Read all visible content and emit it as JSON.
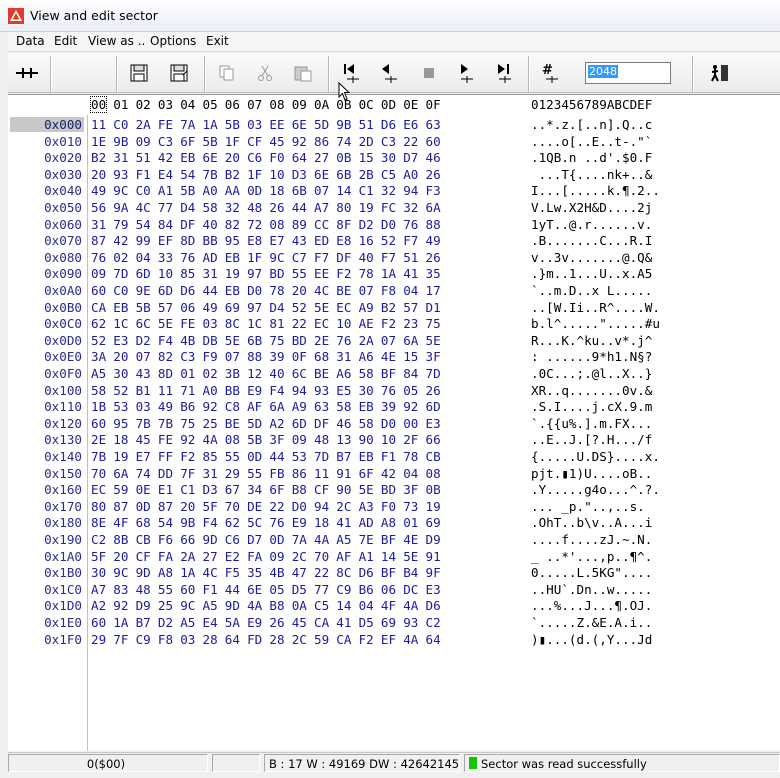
{
  "window": {
    "title": "View and edit sector"
  },
  "menu": [
    "Data",
    "Edit",
    "View as ..",
    "Options",
    "Exit"
  ],
  "toolbar": {
    "sector_value": "2048"
  },
  "header": {
    "cols": [
      "00",
      "01",
      "02",
      "03",
      "04",
      "05",
      "06",
      "07",
      "08",
      "09",
      "0A",
      "0B",
      "0C",
      "0D",
      "0E",
      "0F"
    ],
    "ascii_header": "0123456789ABCDEF"
  },
  "rows": [
    {
      "off": "0x000",
      "hex": [
        "11",
        "C0",
        "2A",
        "FE",
        "7A",
        "1A",
        "5B",
        "03",
        "EE",
        "6E",
        "5D",
        "9B",
        "51",
        "D6",
        "E6",
        "63"
      ],
      "ascii": "..*.z.[..n].Q..c"
    },
    {
      "off": "0x010",
      "hex": [
        "1E",
        "9B",
        "09",
        "C3",
        "6F",
        "5B",
        "1F",
        "CF",
        "45",
        "92",
        "86",
        "74",
        "2D",
        "C3",
        "22",
        "60"
      ],
      "ascii": "....o[..E..t-.\"`"
    },
    {
      "off": "0x020",
      "hex": [
        "B2",
        "31",
        "51",
        "42",
        "EB",
        "6E",
        "20",
        "C6",
        "F0",
        "64",
        "27",
        "0B",
        "15",
        "30",
        "D7",
        "46"
      ],
      "ascii": ".1QB.n ..d'.$0.F"
    },
    {
      "off": "0x030",
      "hex": [
        "20",
        "93",
        "F1",
        "E4",
        "54",
        "7B",
        "B2",
        "1F",
        "10",
        "D3",
        "6E",
        "6B",
        "2B",
        "C5",
        "A0",
        "26"
      ],
      "ascii": " ...T{....nk+..&"
    },
    {
      "off": "0x040",
      "hex": [
        "49",
        "9C",
        "C0",
        "A1",
        "5B",
        "A0",
        "AA",
        "0D",
        "18",
        "6B",
        "07",
        "14",
        "C1",
        "32",
        "94",
        "F3"
      ],
      "ascii": "I...[.....k.¶.2.."
    },
    {
      "off": "0x050",
      "hex": [
        "56",
        "9A",
        "4C",
        "77",
        "D4",
        "58",
        "32",
        "48",
        "26",
        "44",
        "A7",
        "80",
        "19",
        "FC",
        "32",
        "6A"
      ],
      "ascii": "V.Lw.X2H&D....2j"
    },
    {
      "off": "0x060",
      "hex": [
        "31",
        "79",
        "54",
        "84",
        "DF",
        "40",
        "82",
        "72",
        "08",
        "89",
        "CC",
        "8F",
        "D2",
        "D0",
        "76",
        "88"
      ],
      "ascii": "1yT..@.r......v."
    },
    {
      "off": "0x070",
      "hex": [
        "87",
        "42",
        "99",
        "EF",
        "8D",
        "BB",
        "95",
        "E8",
        "E7",
        "43",
        "ED",
        "E8",
        "16",
        "52",
        "F7",
        "49"
      ],
      "ascii": ".B.......C...R.I"
    },
    {
      "off": "0x080",
      "hex": [
        "76",
        "02",
        "04",
        "33",
        "76",
        "AD",
        "EB",
        "1F",
        "9C",
        "C7",
        "F7",
        "DF",
        "40",
        "F7",
        "51",
        "26"
      ],
      "ascii": "v..3v.......@.Q&"
    },
    {
      "off": "0x090",
      "hex": [
        "09",
        "7D",
        "6D",
        "10",
        "85",
        "31",
        "19",
        "97",
        "BD",
        "55",
        "EE",
        "F2",
        "78",
        "1A",
        "41",
        "35"
      ],
      "ascii": ".}m..1...U..x.A5"
    },
    {
      "off": "0x0A0",
      "hex": [
        "60",
        "C0",
        "9E",
        "6D",
        "D6",
        "44",
        "EB",
        "D0",
        "78",
        "20",
        "4C",
        "BE",
        "07",
        "F8",
        "04",
        "17"
      ],
      "ascii": "`..m.D..x L....."
    },
    {
      "off": "0x0B0",
      "hex": [
        "CA",
        "EB",
        "5B",
        "57",
        "06",
        "49",
        "69",
        "97",
        "D4",
        "52",
        "5E",
        "EC",
        "A9",
        "B2",
        "57",
        "D1"
      ],
      "ascii": "..[W.Ii..R^....W."
    },
    {
      "off": "0x0C0",
      "hex": [
        "62",
        "1C",
        "6C",
        "5E",
        "FE",
        "03",
        "8C",
        "1C",
        "81",
        "22",
        "EC",
        "10",
        "AE",
        "F2",
        "23",
        "75"
      ],
      "ascii": "b.l^.....\".....#u"
    },
    {
      "off": "0x0D0",
      "hex": [
        "52",
        "E3",
        "D2",
        "F4",
        "4B",
        "DB",
        "5E",
        "6B",
        "75",
        "BD",
        "2E",
        "76",
        "2A",
        "07",
        "6A",
        "5E"
      ],
      "ascii": "R...K.^ku..v*.j^"
    },
    {
      "off": "0x0E0",
      "hex": [
        "3A",
        "20",
        "07",
        "82",
        "C3",
        "F9",
        "07",
        "88",
        "39",
        "0F",
        "68",
        "31",
        "A6",
        "4E",
        "15",
        "3F"
      ],
      "ascii": ": ......9*h1.N§?"
    },
    {
      "off": "0x0F0",
      "hex": [
        "A5",
        "30",
        "43",
        "8D",
        "01",
        "02",
        "3B",
        "12",
        "40",
        "6C",
        "BE",
        "A6",
        "58",
        "BF",
        "84",
        "7D"
      ],
      "ascii": ".0C...;.@l..X..}"
    },
    {
      "off": "0x100",
      "hex": [
        "58",
        "52",
        "B1",
        "11",
        "71",
        "A0",
        "BB",
        "E9",
        "F4",
        "94",
        "93",
        "E5",
        "30",
        "76",
        "05",
        "26"
      ],
      "ascii": "XR..q.......0v.&"
    },
    {
      "off": "0x110",
      "hex": [
        "1B",
        "53",
        "03",
        "49",
        "B6",
        "92",
        "C8",
        "AF",
        "6A",
        "A9",
        "63",
        "58",
        "EB",
        "39",
        "92",
        "6D"
      ],
      "ascii": ".S.I....j.cX.9.m"
    },
    {
      "off": "0x120",
      "hex": [
        "60",
        "95",
        "7B",
        "7B",
        "75",
        "25",
        "BE",
        "5D",
        "A2",
        "6D",
        "DF",
        "46",
        "58",
        "D0",
        "00",
        "E3"
      ],
      "ascii": "`.{{u%.].m.FX..."
    },
    {
      "off": "0x130",
      "hex": [
        "2E",
        "18",
        "45",
        "FE",
        "92",
        "4A",
        "08",
        "5B",
        "3F",
        "09",
        "48",
        "13",
        "90",
        "10",
        "2F",
        "66"
      ],
      "ascii": "..E..J.[?.H.../f"
    },
    {
      "off": "0x140",
      "hex": [
        "7B",
        "19",
        "E7",
        "FF",
        "F2",
        "85",
        "55",
        "0D",
        "44",
        "53",
        "7D",
        "B7",
        "EB",
        "F1",
        "78",
        "CB"
      ],
      "ascii": "{.....U.DS}....x."
    },
    {
      "off": "0x150",
      "hex": [
        "70",
        "6A",
        "74",
        "DD",
        "7F",
        "31",
        "29",
        "55",
        "FB",
        "86",
        "11",
        "91",
        "6F",
        "42",
        "04",
        "08"
      ],
      "ascii": "pjt.▮1)U....oB.."
    },
    {
      "off": "0x160",
      "hex": [
        "EC",
        "59",
        "0E",
        "E1",
        "C1",
        "D3",
        "67",
        "34",
        "6F",
        "B8",
        "CF",
        "90",
        "5E",
        "BD",
        "3F",
        "0B"
      ],
      "ascii": ".Y.....g4o...^.?."
    },
    {
      "off": "0x170",
      "hex": [
        "80",
        "87",
        "0D",
        "87",
        "20",
        "5F",
        "70",
        "DE",
        "22",
        "D0",
        "94",
        "2C",
        "A3",
        "F0",
        "73",
        "19"
      ],
      "ascii": "... _p.\"..,..s."
    },
    {
      "off": "0x180",
      "hex": [
        "8E",
        "4F",
        "68",
        "54",
        "9B",
        "F4",
        "62",
        "5C",
        "76",
        "E9",
        "18",
        "41",
        "AD",
        "A8",
        "01",
        "69"
      ],
      "ascii": ".OhT..b\\v..A...i"
    },
    {
      "off": "0x190",
      "hex": [
        "C2",
        "8B",
        "CB",
        "F6",
        "66",
        "9D",
        "C6",
        "D7",
        "0D",
        "7A",
        "4A",
        "A5",
        "7E",
        "BF",
        "4E",
        "D9"
      ],
      "ascii": "....f....zJ.~.N."
    },
    {
      "off": "0x1A0",
      "hex": [
        "5F",
        "20",
        "CF",
        "FA",
        "2A",
        "27",
        "E2",
        "FA",
        "09",
        "2C",
        "70",
        "AF",
        "A1",
        "14",
        "5E",
        "91"
      ],
      "ascii": "_ ..*'...,p..¶^."
    },
    {
      "off": "0x1B0",
      "hex": [
        "30",
        "9C",
        "9D",
        "A8",
        "1A",
        "4C",
        "F5",
        "35",
        "4B",
        "47",
        "22",
        "8C",
        "D6",
        "BF",
        "B4",
        "9F"
      ],
      "ascii": "0.....L.5KG\"...."
    },
    {
      "off": "0x1C0",
      "hex": [
        "A7",
        "83",
        "48",
        "55",
        "60",
        "F1",
        "44",
        "6E",
        "05",
        "D5",
        "77",
        "C9",
        "B6",
        "06",
        "DC",
        "E3"
      ],
      "ascii": "..HU`.Dn..w....."
    },
    {
      "off": "0x1D0",
      "hex": [
        "A2",
        "92",
        "D9",
        "25",
        "9C",
        "A5",
        "9D",
        "4A",
        "B8",
        "0A",
        "C5",
        "14",
        "04",
        "4F",
        "4A",
        "D6"
      ],
      "ascii": "...%...J...¶.OJ."
    },
    {
      "off": "0x1E0",
      "hex": [
        "60",
        "1A",
        "B7",
        "D2",
        "A5",
        "E4",
        "5A",
        "E9",
        "26",
        "45",
        "CA",
        "41",
        "D5",
        "69",
        "93",
        "C2"
      ],
      "ascii": "`.....Z.&E.A.i.."
    },
    {
      "off": "0x1F0",
      "hex": [
        "29",
        "7F",
        "C9",
        "F8",
        "03",
        "28",
        "64",
        "FD",
        "28",
        "2C",
        "59",
        "CA",
        "F2",
        "EF",
        "4A",
        "64"
      ],
      "ascii": ")▮...(d.(,Y...Jd"
    }
  ],
  "status": {
    "position": "0($00)",
    "values": "B : 17 W : 49169 DW : 4264214545",
    "message": "Sector was read successfully"
  },
  "colors": {
    "hex_text": "#1c1c9c",
    "offset_text": "#2b2b8f",
    "status_ok": "#12c400"
  }
}
